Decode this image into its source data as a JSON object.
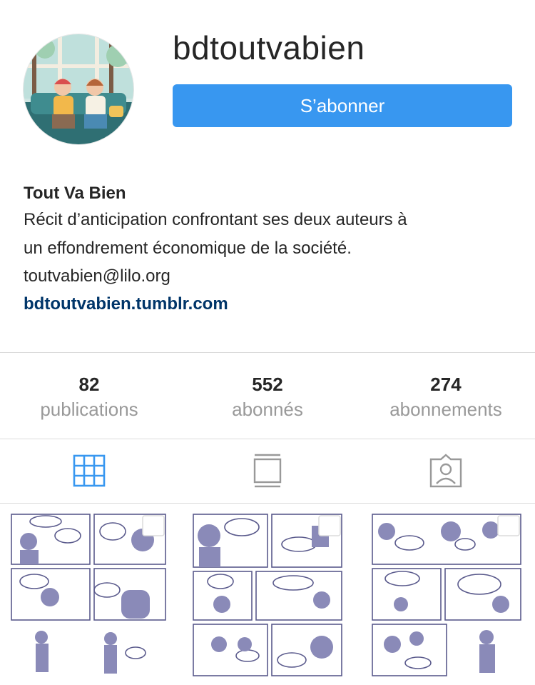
{
  "profile": {
    "username": "bdtoutvabien",
    "follow_label": "S’abonner"
  },
  "bio": {
    "name": "Tout Va Bien",
    "line1": "Récit d’anticipation confrontant ses deux auteurs à",
    "line2": "un effondrement économique de la société.",
    "email": "toutvabien@lilo.org",
    "link": "bdtoutvabien.tumblr.com"
  },
  "stats": [
    {
      "value": "82",
      "label": "publications"
    },
    {
      "value": "552",
      "label": "abonnés"
    },
    {
      "value": "274",
      "label": "abonnements"
    }
  ],
  "tabs": [
    {
      "icon": "grid-icon",
      "active": true
    },
    {
      "icon": "feed-icon",
      "active": false
    },
    {
      "icon": "tagged-icon",
      "active": false
    }
  ],
  "posts": [
    {
      "icon": "multi-photo-icon"
    },
    {
      "icon": "multi-photo-icon"
    },
    {
      "icon": "multi-photo-icon"
    }
  ],
  "colors": {
    "follow_button": "#3897f0",
    "link": "#003569",
    "active_tab": "#3897f0",
    "inactive_tab": "#999999",
    "comic_ink": "#5a5a8c"
  }
}
